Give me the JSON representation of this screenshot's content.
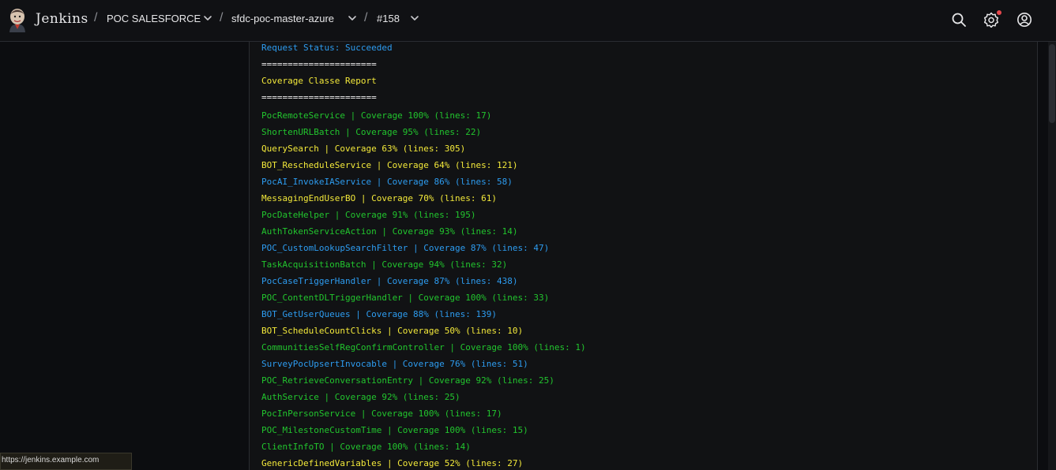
{
  "header": {
    "brand": "Jenkins",
    "breadcrumbs": [
      "POC SALESFORCE",
      "sfdc-poc-master-azure",
      "#158"
    ],
    "separator": "/"
  },
  "colors": {
    "blue": "#2d9cf0",
    "yellow": "#f3e93a",
    "green": "#22c52e",
    "notification": "#e5484d"
  },
  "icons": [
    "jenkins-logo-icon",
    "chevron-down-icon",
    "search-icon",
    "gear-icon",
    "account-icon"
  ],
  "console": {
    "request_status": "Request Status: Succeeded",
    "divider": "======================",
    "report_title": "Coverage Classe Report",
    "rows": [
      {
        "text": "PocRemoteService | Coverage 100% (lines: 17)",
        "color": "green"
      },
      {
        "text": "ShortenURLBatch | Coverage 95% (lines: 22)",
        "color": "green"
      },
      {
        "text": "QuerySearch | Coverage 63% (lines: 305)",
        "color": "yellow"
      },
      {
        "text": "BOT_RescheduleService | Coverage 64% (lines: 121)",
        "color": "yellow"
      },
      {
        "text": "PocAI_InvokeIAService | Coverage 86% (lines: 58)",
        "color": "blue"
      },
      {
        "text": "MessagingEndUserBO | Coverage 70% (lines: 61)",
        "color": "yellow"
      },
      {
        "text": "PocDateHelper | Coverage 91% (lines: 195)",
        "color": "green"
      },
      {
        "text": "AuthTokenServiceAction | Coverage 93% (lines: 14)",
        "color": "green"
      },
      {
        "text": "POC_CustomLookupSearchFilter | Coverage 87% (lines: 47)",
        "color": "blue"
      },
      {
        "text": "TaskAcquisitionBatch | Coverage 94% (lines: 32)",
        "color": "green"
      },
      {
        "text": "PocCaseTriggerHandler | Coverage 87% (lines: 438)",
        "color": "blue"
      },
      {
        "text": "POC_ContentDLTriggerHandler | Coverage 100% (lines: 33)",
        "color": "green"
      },
      {
        "text": "BOT_GetUserQueues | Coverage 88% (lines: 139)",
        "color": "blue"
      },
      {
        "text": "BOT_ScheduleCountClicks | Coverage 50% (lines: 10)",
        "color": "yellow"
      },
      {
        "text": "CommunitiesSelfRegConfirmController | Coverage 100% (lines: 1)",
        "color": "green"
      },
      {
        "text": "SurveyPocUpsertInvocable | Coverage 76% (lines: 51)",
        "color": "blue"
      },
      {
        "text": "POC_RetrieveConversationEntry | Coverage 92% (lines: 25)",
        "color": "green"
      },
      {
        "text": "AuthService | Coverage 92% (lines: 25)",
        "color": "green"
      },
      {
        "text": "PocInPersonService | Coverage 100% (lines: 17)",
        "color": "green"
      },
      {
        "text": "POC_MilestoneCustomTime | Coverage 100% (lines: 15)",
        "color": "green"
      },
      {
        "text": "ClientInfoTO | Coverage 100% (lines: 14)",
        "color": "green"
      },
      {
        "text": "GenericDefinedVariables | Coverage 52% (lines: 27)",
        "color": "yellow"
      }
    ]
  },
  "statusbar": {
    "url": "https://jenkins.example.com"
  }
}
